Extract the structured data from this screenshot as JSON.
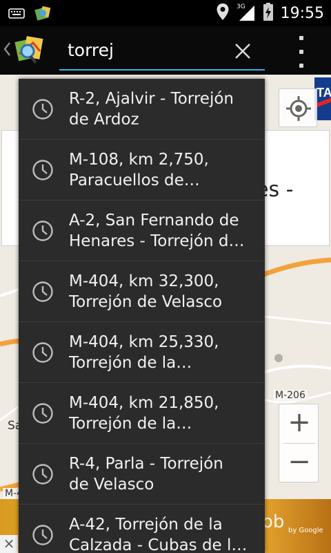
{
  "status_bar": {
    "time": "19:55",
    "network": "3G",
    "icons": [
      "keyboard-icon",
      "app-notification-icon",
      "location-icon",
      "signal-icon",
      "battery-charging-icon"
    ]
  },
  "action_bar": {
    "search_value": "torrej",
    "search_placeholder": "",
    "accent_color": "#33b5e5"
  },
  "suggestions": [
    {
      "line1": "R-2, Ajalvir - Torrejón",
      "line2": "de Ardoz",
      "icon": "history-clock-icon"
    },
    {
      "line1": "M-108, km 2,750,",
      "line2": "Paracuellos de…",
      "icon": "history-clock-icon"
    },
    {
      "line1": "A-2, San Fernando de",
      "line2": "Henares - Torrejón d…",
      "icon": "history-clock-icon"
    },
    {
      "line1": "M-404, km 32,300,",
      "line2": "Torrejón de Velasco",
      "icon": "history-clock-icon"
    },
    {
      "line1": "M-404, km 25,330,",
      "line2": "Torrejón de la…",
      "icon": "history-clock-icon"
    },
    {
      "line1": "M-404, km 21,850,",
      "line2": "Torrejón de la…",
      "icon": "history-clock-icon"
    },
    {
      "line1": "R-4, Parla - Torrejón",
      "line2": "de Velasco",
      "icon": "history-clock-icon"
    },
    {
      "line1": "A-42, Torrejón de la",
      "line2": "Calzada - Cubas de l…",
      "icon": "history-clock-icon"
    }
  ],
  "map": {
    "info_card_fragment": "es -",
    "road_labels": {
      "m206": "M-206",
      "m4": "M-4",
      "sa": "Sa"
    },
    "zoom_in": "+",
    "zoom_out": "−",
    "tile_corner": "TA"
  },
  "ad": {
    "close": "×",
    "text": "ob",
    "byline": "by Google"
  }
}
